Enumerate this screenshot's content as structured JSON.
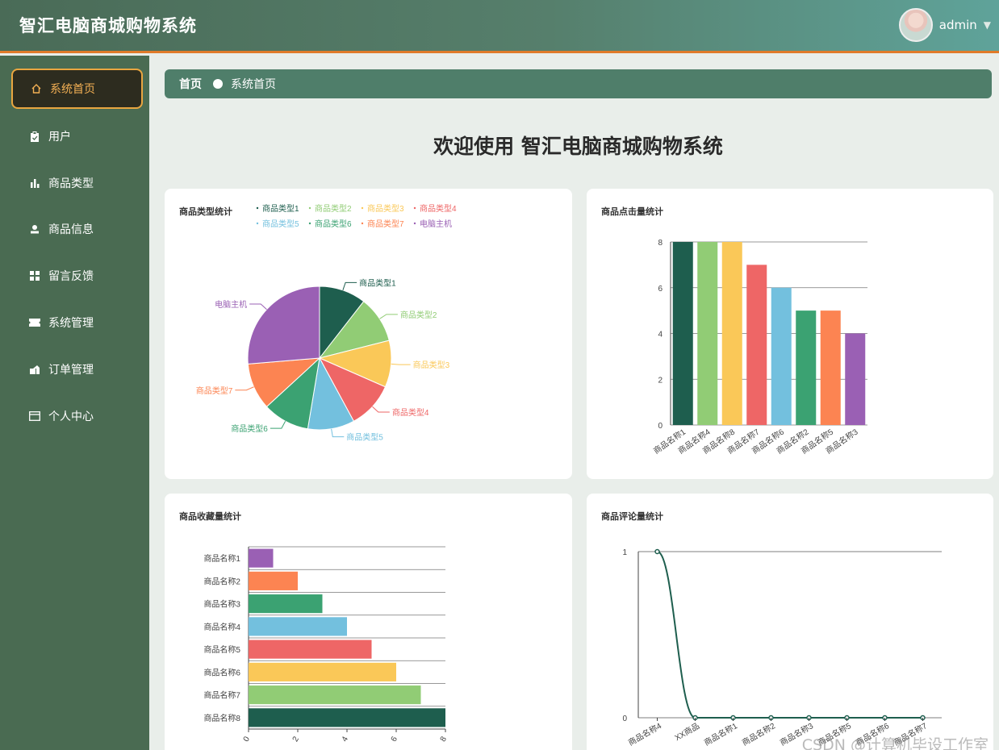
{
  "header": {
    "title": "智汇电脑商城购物系统",
    "user": "admin"
  },
  "sidebar": {
    "items": [
      {
        "label": "系统首页",
        "icon": "home-icon"
      },
      {
        "label": "用户",
        "icon": "clipboard-icon"
      },
      {
        "label": "商品类型",
        "icon": "bar-chart-icon"
      },
      {
        "label": "商品信息",
        "icon": "person-icon"
      },
      {
        "label": "留言反馈",
        "icon": "grid-icon"
      },
      {
        "label": "系统管理",
        "icon": "ticket-icon"
      },
      {
        "label": "订单管理",
        "icon": "box-icon"
      },
      {
        "label": "个人中心",
        "icon": "card-icon"
      }
    ]
  },
  "breadcrumb": {
    "home": "首页",
    "current": "系统首页"
  },
  "welcome": "欢迎使用 智汇电脑商城购物系统",
  "watermark": "CSDN @计算机毕设工作室",
  "chart_data": [
    {
      "type": "pie",
      "title": "商品类型统计",
      "legend": "top",
      "categories": [
        "商品类型1",
        "商品类型2",
        "商品类型3",
        "商品类型4",
        "商品类型5",
        "商品类型6",
        "商品类型7",
        "电脑主机"
      ],
      "values": [
        1,
        1,
        1,
        1,
        1,
        1,
        1,
        2.5
      ],
      "colors": [
        "#1e5e4e",
        "#91cc75",
        "#fac858",
        "#ee6666",
        "#73c0de",
        "#3ba272",
        "#fc8452",
        "#9a60b4"
      ]
    },
    {
      "type": "bar",
      "title": "商品点击量统计",
      "categories": [
        "商品名称1",
        "商品名称4",
        "商品名称8",
        "商品名称7",
        "商品名称6",
        "商品名称2",
        "商品名称5",
        "商品名称3"
      ],
      "values": [
        8,
        8,
        8,
        7,
        6,
        5,
        5,
        4
      ],
      "ylim": [
        0,
        8
      ],
      "yticks": [
        "0",
        "2",
        "4",
        "6",
        "8"
      ],
      "colors": [
        "#1e5e4e",
        "#91cc75",
        "#fac858",
        "#ee6666",
        "#73c0de",
        "#3ba272",
        "#fc8452",
        "#9a60b4"
      ]
    },
    {
      "type": "bar",
      "orientation": "horizontal",
      "title": "商品收藏量统计",
      "categories": [
        "商品名称1",
        "商品名称2",
        "商品名称3",
        "商品名称4",
        "商品名称5",
        "商品名称6",
        "商品名称7",
        "商品名称8"
      ],
      "values": [
        1,
        2,
        3,
        4,
        5,
        6,
        7,
        8
      ],
      "xlim": [
        0,
        8
      ],
      "xticks": [
        "0",
        "2",
        "4",
        "6",
        "8"
      ],
      "colors": [
        "#9a60b4",
        "#fc8452",
        "#3ba272",
        "#73c0de",
        "#ee6666",
        "#fac858",
        "#91cc75",
        "#1e5e4e"
      ]
    },
    {
      "type": "line",
      "title": "商品评论量统计",
      "categories": [
        "商品名称4",
        "XX商品",
        "商品名称1",
        "商品名称2",
        "商品名称3",
        "商品名称5",
        "商品名称6",
        "商品名称7"
      ],
      "values": [
        1,
        0,
        0,
        0,
        0,
        0,
        0,
        0
      ],
      "ylim": [
        0,
        1
      ],
      "yticks": [
        "0",
        "1"
      ],
      "color": "#1e5e4e"
    }
  ]
}
